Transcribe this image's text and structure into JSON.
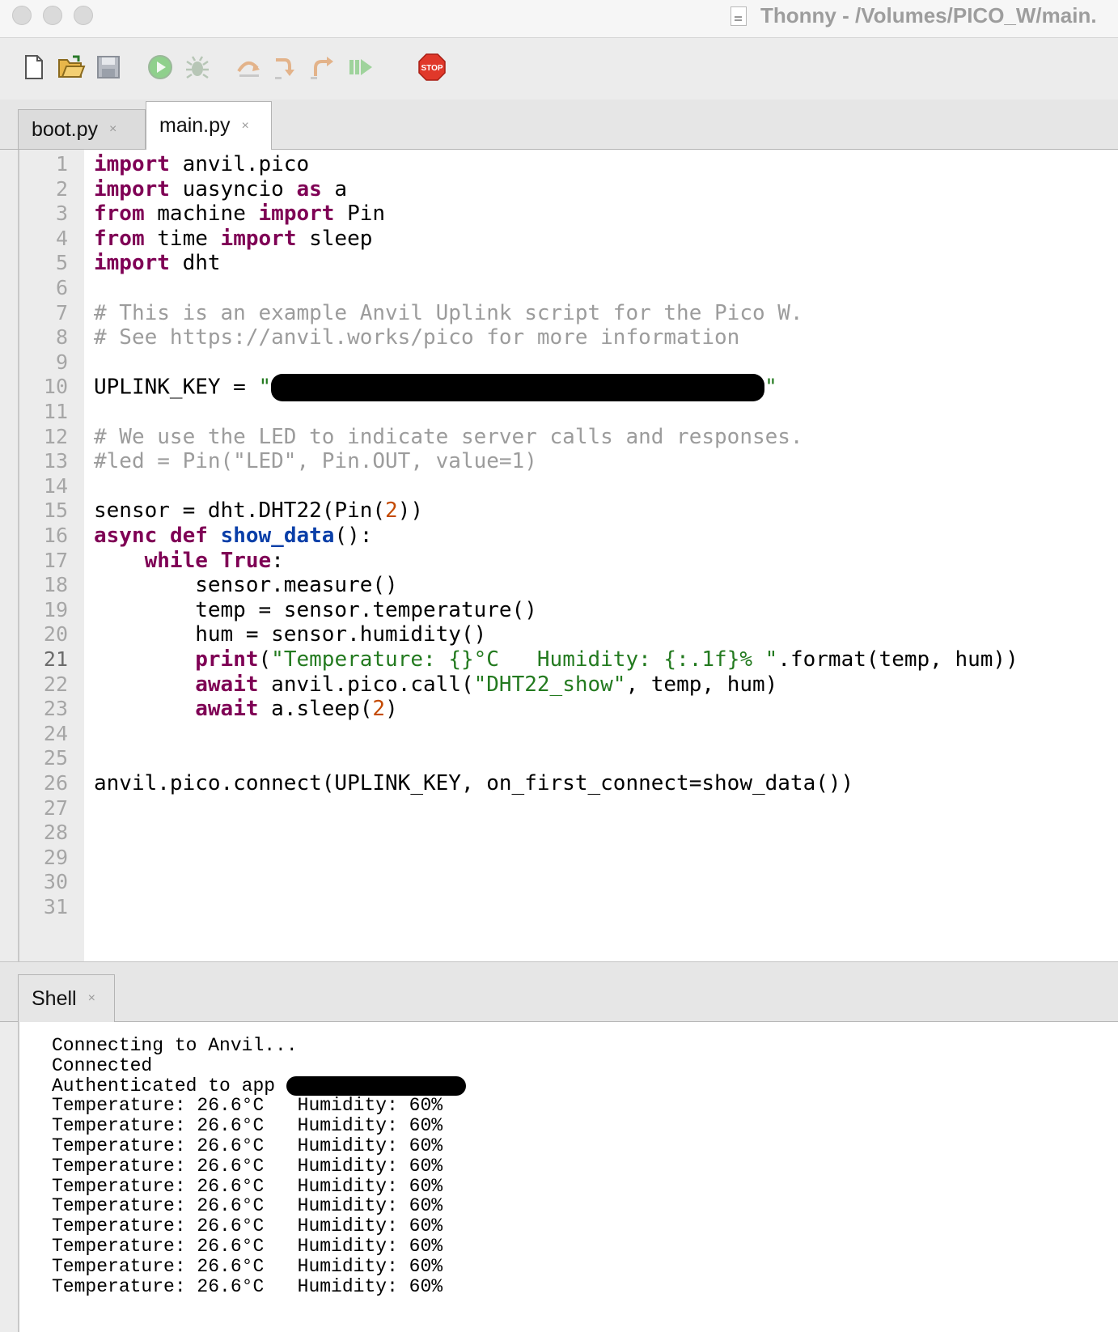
{
  "window": {
    "title": "Thonny  -  /Volumes/PICO_W/main."
  },
  "toolbar": {
    "buttons": [
      {
        "name": "new-file-icon"
      },
      {
        "name": "open-file-icon"
      },
      {
        "name": "save-file-icon"
      },
      {
        "name": "run-icon"
      },
      {
        "name": "debug-icon"
      },
      {
        "name": "step-over-icon"
      },
      {
        "name": "step-into-icon"
      },
      {
        "name": "step-out-icon"
      },
      {
        "name": "resume-icon"
      },
      {
        "name": "stop-icon",
        "label": "STOP"
      }
    ]
  },
  "tabs": [
    {
      "label": "boot.py",
      "active": false
    },
    {
      "label": "main.py",
      "active": true
    }
  ],
  "close_glyph": "×",
  "editor": {
    "active_line": 21,
    "line_numbers": [
      "1",
      "2",
      "3",
      "4",
      "5",
      "6",
      "7",
      "8",
      "9",
      "10",
      "11",
      "12",
      "13",
      "14",
      "15",
      "16",
      "17",
      "18",
      "19",
      "20",
      "21",
      "22",
      "23",
      "24",
      "25",
      "26",
      "27",
      "28",
      "29",
      "30",
      "31"
    ],
    "lines": [
      [
        {
          "t": "import",
          "c": "kw"
        },
        {
          "t": " anvil.pico"
        }
      ],
      [
        {
          "t": "import",
          "c": "kw"
        },
        {
          "t": " uasyncio "
        },
        {
          "t": "as",
          "c": "kw"
        },
        {
          "t": " a"
        }
      ],
      [
        {
          "t": "from",
          "c": "kw"
        },
        {
          "t": " machine "
        },
        {
          "t": "import",
          "c": "kw"
        },
        {
          "t": " Pin"
        }
      ],
      [
        {
          "t": "from",
          "c": "kw"
        },
        {
          "t": " time "
        },
        {
          "t": "import",
          "c": "kw"
        },
        {
          "t": " sleep"
        }
      ],
      [
        {
          "t": "import",
          "c": "kw"
        },
        {
          "t": " dht"
        }
      ],
      [],
      [
        {
          "t": "# This is an example Anvil Uplink script for the Pico W.",
          "c": "cm"
        }
      ],
      [
        {
          "t": "# See https://anvil.works/pico for more information",
          "c": "cm"
        }
      ],
      [],
      [
        {
          "t": "UPLINK_KEY = "
        },
        {
          "t": "\"",
          "c": "str"
        },
        {
          "redact": true,
          "w": 610,
          "h": 34
        },
        {
          "t": "\"",
          "c": "str"
        }
      ],
      [],
      [
        {
          "t": "# We use the LED to indicate server calls and responses.",
          "c": "cm"
        }
      ],
      [
        {
          "t": "#led = Pin(\"LED\", Pin.OUT, value=1)",
          "c": "cm"
        }
      ],
      [],
      [
        {
          "t": "sensor = dht.DHT22(Pin("
        },
        {
          "t": "2",
          "c": "num"
        },
        {
          "t": "))"
        }
      ],
      [
        {
          "t": "async",
          "c": "kw"
        },
        {
          "t": " "
        },
        {
          "t": "def",
          "c": "kw"
        },
        {
          "t": " "
        },
        {
          "t": "show_data",
          "c": "fn"
        },
        {
          "t": "():"
        }
      ],
      [
        {
          "t": "    "
        },
        {
          "t": "while",
          "c": "kw"
        },
        {
          "t": " "
        },
        {
          "t": "True",
          "c": "kw"
        },
        {
          "t": ":"
        }
      ],
      [
        {
          "t": "        sensor.measure()"
        }
      ],
      [
        {
          "t": "        temp = sensor.temperature()"
        }
      ],
      [
        {
          "t": "        hum = sensor.humidity()"
        }
      ],
      [
        {
          "t": "        "
        },
        {
          "t": "print",
          "c": "kw"
        },
        {
          "t": "("
        },
        {
          "t": "\"Temperature: {}°C   Humidity: {:.1f}% \"",
          "c": "str"
        },
        {
          "t": ".format(temp, hum))"
        }
      ],
      [
        {
          "t": "        "
        },
        {
          "t": "await",
          "c": "kw"
        },
        {
          "t": " anvil.pico.call("
        },
        {
          "t": "\"DHT22_show\"",
          "c": "str"
        },
        {
          "t": ", temp, hum)"
        }
      ],
      [
        {
          "t": "        "
        },
        {
          "t": "await",
          "c": "kw"
        },
        {
          "t": " a.sleep("
        },
        {
          "t": "2",
          "c": "num"
        },
        {
          "t": ")"
        }
      ],
      [],
      [],
      [
        {
          "t": "anvil.pico.connect(UPLINK_KEY, on_first_connect=show_data())"
        }
      ],
      [],
      [],
      [],
      [],
      []
    ]
  },
  "shell": {
    "tab_label": "Shell",
    "lines": [
      [
        {
          "t": "Connecting to Anvil..."
        }
      ],
      [
        {
          "t": "Connected"
        }
      ],
      [
        {
          "t": "Authenticated to app "
        },
        {
          "redact": true,
          "w": 222,
          "h": 24
        }
      ],
      [
        {
          "t": "Temperature: 26.6°C   Humidity: 60%"
        }
      ],
      [
        {
          "t": "Temperature: 26.6°C   Humidity: 60%"
        }
      ],
      [
        {
          "t": "Temperature: 26.6°C   Humidity: 60%"
        }
      ],
      [
        {
          "t": "Temperature: 26.6°C   Humidity: 60%"
        }
      ],
      [
        {
          "t": "Temperature: 26.6°C   Humidity: 60%"
        }
      ],
      [
        {
          "t": "Temperature: 26.6°C   Humidity: 60%"
        }
      ],
      [
        {
          "t": "Temperature: 26.6°C   Humidity: 60%"
        }
      ],
      [
        {
          "t": "Temperature: 26.6°C   Humidity: 60%"
        }
      ],
      [
        {
          "t": "Temperature: 26.6°C   Humidity: 60%"
        }
      ],
      [
        {
          "t": "Temperature: 26.6°C   Humidity: 60%"
        }
      ]
    ]
  },
  "colors": {
    "keyword": "#7f0055",
    "function": "#0a3fa8",
    "string": "#237a1f",
    "number": "#c44a00",
    "comment": "#9c9c9c",
    "stop_button": "#e0382a"
  }
}
